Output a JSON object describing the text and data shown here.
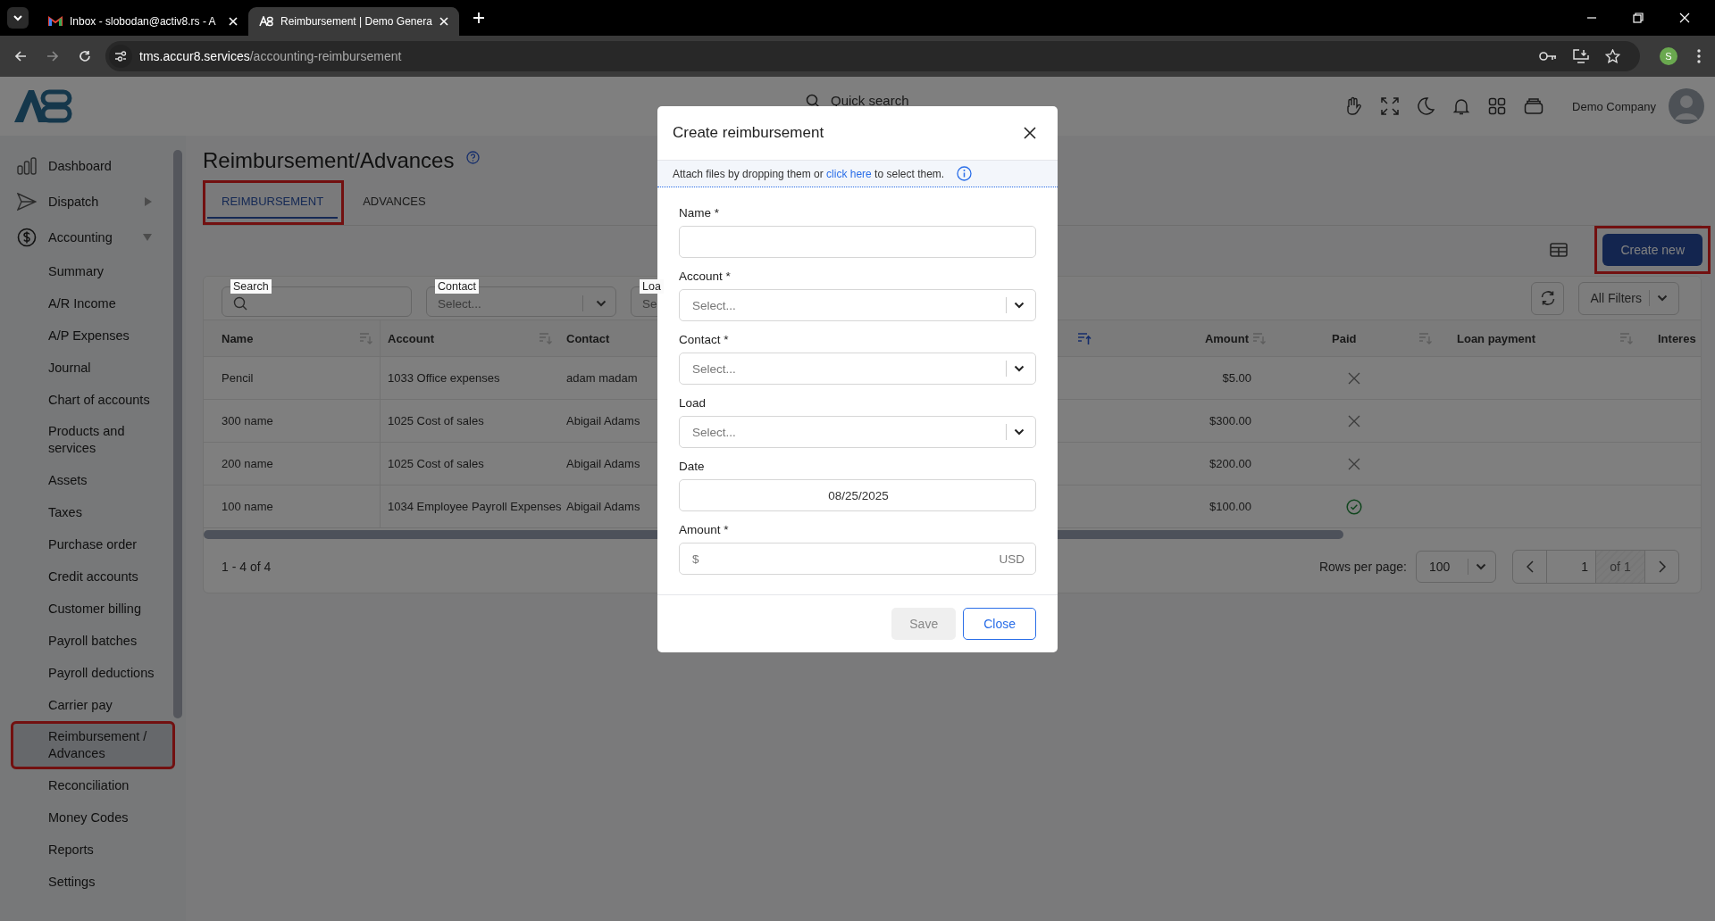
{
  "browser": {
    "tabs": [
      {
        "title": "Inbox - slobodan@activ8.rs - A",
        "kind": "mail",
        "selected": false
      },
      {
        "title": "Reimbursement | Demo Genera",
        "kind": "app",
        "selected": true
      }
    ],
    "url_host": "tms.accur8.services",
    "url_path": "/accounting-reimbursement",
    "profile_initial": "S"
  },
  "header": {
    "search_placeholder": "Quick search",
    "company": "Demo Company"
  },
  "sidebar": {
    "items": [
      {
        "label": "Dashboard",
        "selected": false,
        "highlighted": false
      },
      {
        "label": "Dispatch",
        "selected": false,
        "highlighted": false,
        "expanded": false
      },
      {
        "label": "Accounting",
        "selected": false,
        "highlighted": false,
        "expanded": true,
        "children": [
          {
            "label": "Summary",
            "selected": false,
            "highlighted": false
          },
          {
            "label": "A/R Income",
            "selected": false,
            "highlighted": false
          },
          {
            "label": "A/P Expenses",
            "selected": false,
            "highlighted": false
          },
          {
            "label": "Journal",
            "selected": false,
            "highlighted": false
          },
          {
            "label": "Chart of accounts",
            "selected": false,
            "highlighted": false
          },
          {
            "label": "Products and services",
            "selected": false,
            "highlighted": false
          },
          {
            "label": "Assets",
            "selected": false,
            "highlighted": false
          },
          {
            "label": "Taxes",
            "selected": false,
            "highlighted": false
          },
          {
            "label": "Purchase order",
            "selected": false,
            "highlighted": false
          },
          {
            "label": "Credit accounts",
            "selected": false,
            "highlighted": false
          },
          {
            "label": "Customer billing",
            "selected": false,
            "highlighted": false
          },
          {
            "label": "Payroll batches",
            "selected": false,
            "highlighted": false
          },
          {
            "label": "Payroll deductions",
            "selected": false,
            "highlighted": false
          },
          {
            "label": "Carrier pay",
            "selected": false,
            "highlighted": false
          },
          {
            "label": "Reimbursement / Advances",
            "selected": true,
            "highlighted": true
          },
          {
            "label": "Reconciliation",
            "selected": false,
            "highlighted": false
          },
          {
            "label": "Money Codes",
            "selected": false,
            "highlighted": false
          },
          {
            "label": "Reports",
            "selected": false,
            "highlighted": false
          },
          {
            "label": "Settings",
            "selected": false,
            "highlighted": false
          }
        ]
      }
    ]
  },
  "page": {
    "title": "Reimbursement/Advances",
    "tabs": [
      {
        "label": "REIMBURSEMENT",
        "selected": true,
        "highlighted": true
      },
      {
        "label": "ADVANCES",
        "selected": false,
        "highlighted": false
      }
    ],
    "create_button": {
      "label": "Create new",
      "highlighted": true
    },
    "filters": [
      {
        "label": "Search",
        "kind": "search"
      },
      {
        "label": "Contact",
        "kind": "select",
        "placeholder": "Select..."
      },
      {
        "label": "Loa",
        "kind": "select",
        "placeholder": "Se"
      }
    ],
    "all_filters": "All Filters",
    "table": {
      "columns": [
        {
          "label": "Name",
          "sortable": true,
          "sorted": false
        },
        {
          "label": "Account",
          "sortable": true,
          "sorted": false
        },
        {
          "label": "Contact",
          "sortable": false
        },
        {
          "sortable": true,
          "sorted": true
        },
        {
          "label": "Amount",
          "sortable": true,
          "sorted": false
        },
        {
          "label": "Paid",
          "sortable": true,
          "sorted": false
        },
        {
          "label": "Loan payment",
          "sortable": true,
          "sorted": false
        },
        {
          "label": "Interes",
          "sortable": false
        }
      ],
      "rows": [
        {
          "name": "Pencil",
          "account": "1033 Office expenses",
          "contact": "adam madam",
          "amount": "$5.00",
          "paid": false
        },
        {
          "name": "300 name",
          "account": "1025 Cost of sales",
          "contact": "Abigail Adams",
          "amount": "$300.00",
          "paid": false
        },
        {
          "name": "200 name",
          "account": "1025 Cost of sales",
          "contact": "Abigail Adams",
          "amount": "$200.00",
          "paid": false
        },
        {
          "name": "100 name",
          "account": "1034 Employee Payroll Expenses",
          "contact": "Abigail Adams",
          "amount": "$100.00",
          "paid": true
        }
      ]
    },
    "footer": {
      "range": "1 - 4 of 4",
      "rows_per_page_label": "Rows per page:",
      "rows_per_page": "100",
      "page": "1",
      "page_count": "of 1"
    }
  },
  "modal": {
    "title": "Create reimbursement",
    "attach": {
      "before": "Attach files by dropping them or",
      "link": "click here",
      "after": "to select them."
    },
    "fields": [
      {
        "label": "Name *",
        "kind": "text"
      },
      {
        "label": "Account *",
        "kind": "select",
        "placeholder": "Select..."
      },
      {
        "label": "Contact *",
        "kind": "select",
        "placeholder": "Select..."
      },
      {
        "label": "Load",
        "kind": "select",
        "placeholder": "Select..."
      },
      {
        "label": "Date",
        "kind": "date",
        "value": "08/25/2025"
      },
      {
        "label": "Amount *",
        "kind": "currency",
        "prefix": "$",
        "suffix": "USD"
      }
    ],
    "buttons": [
      {
        "label": "Save",
        "kind": "secondary",
        "disabled": true
      },
      {
        "label": "Close",
        "kind": "outline",
        "disabled": false
      }
    ]
  }
}
